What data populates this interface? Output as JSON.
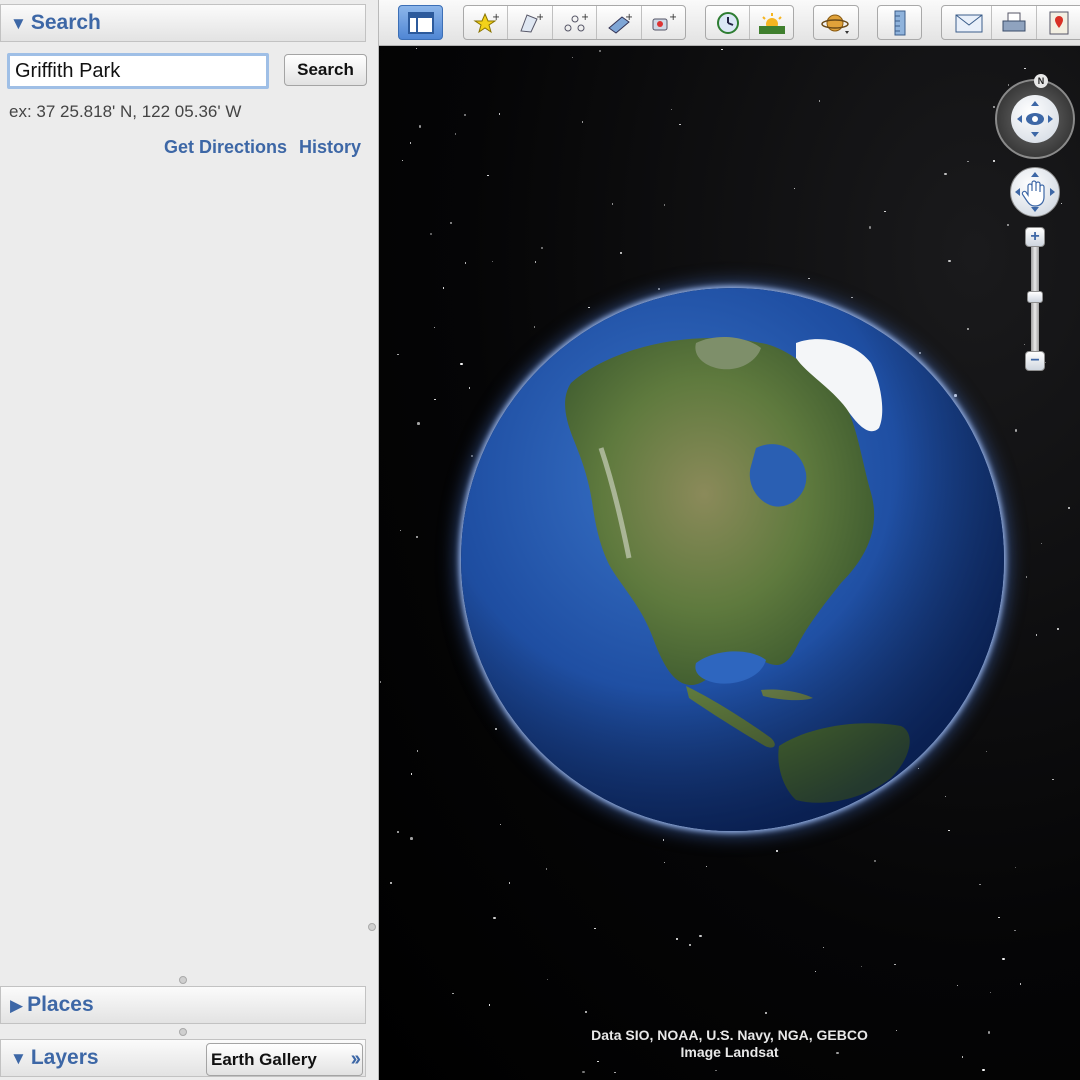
{
  "search_panel": {
    "title": "Search",
    "input_value": "Griffith Park",
    "button_label": "Search",
    "example_text": "ex: 37 25.818' N, 122 05.36' W",
    "links": [
      "Get Directions",
      "History"
    ]
  },
  "places_panel": {
    "title": "Places"
  },
  "layers_panel": {
    "title": "Layers",
    "gallery_button": "Earth Gallery"
  },
  "toolbar": {
    "buttons": [
      {
        "icon": "sidebar-toggle-icon",
        "active": true
      },
      {
        "icon": "add-placemark-icon"
      },
      {
        "icon": "add-polygon-icon"
      },
      {
        "icon": "add-path-icon"
      },
      {
        "icon": "add-image-overlay-icon"
      },
      {
        "icon": "record-tour-icon"
      },
      {
        "icon": "historical-imagery-icon"
      },
      {
        "icon": "sunlight-icon"
      },
      {
        "icon": "planets-icon"
      },
      {
        "icon": "ruler-icon"
      },
      {
        "icon": "email-icon"
      },
      {
        "icon": "print-icon"
      },
      {
        "icon": "view-in-google-maps-icon"
      }
    ]
  },
  "viewport": {
    "attribution_line1": "Data SIO, NOAA, U.S. Navy, NGA, GEBCO",
    "attribution_line2": "Image Landsat",
    "compass_label": "N",
    "zoom_in": "+",
    "zoom_out": "−"
  },
  "colors": {
    "panel_accent": "#3d67a6",
    "panel_bg": "#ececec",
    "space": "#000000",
    "ocean": "#1f4fa3"
  }
}
